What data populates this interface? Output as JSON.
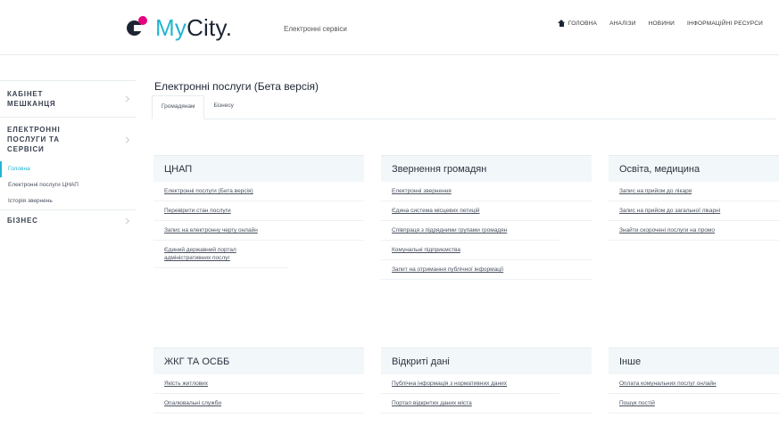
{
  "header": {
    "logo": {
      "my": "My",
      "city": "City.",
      "mark_icon": "mycity-logo-mark"
    },
    "subtitle": "Електронні сервіси",
    "nav": [
      {
        "label": "ГОЛОВНА",
        "icon": "home-icon"
      },
      {
        "label": "АНАЛІЗИ"
      },
      {
        "label": "НОВИНИ"
      },
      {
        "label": "ІНФОРМАЦІЙНІ РЕСУРСИ"
      }
    ]
  },
  "sidebar": {
    "sections": [
      {
        "title": "КАБІНЕТ МЕШКАНЦЯ"
      },
      {
        "title": "ЕЛЕКТРОННІ ПОСЛУГИ ТА СЕРВІСИ"
      },
      {
        "title": "БІЗНЕС"
      }
    ],
    "items": [
      "Головна",
      "Електронні послуги ЦНАП",
      "Історія звернень"
    ]
  },
  "main": {
    "title": "Електронні послуги (Бета версія)",
    "tabs": [
      "Громадянам",
      "Бізнесу"
    ]
  },
  "cards": [
    {
      "title": "ЦНАП",
      "links": [
        "Електронні послуги (Бета версія)",
        "Перевірити стан послуги",
        "Запис на електронну чергу онлайн",
        "Єдиний державний портал адміністративних послуг"
      ]
    },
    {
      "title": "Звернення громадян",
      "links": [
        "Електронні звернення",
        "Єдина система місцевих петицій",
        "Співпраця з підрядними групами громадян",
        "Комунальні підприємства",
        "Запит на отримання публічної інформації"
      ]
    },
    {
      "title": "Освіта, медицина",
      "links": [
        "Запис на прийом до лікаря",
        "Запис на прийом до загальної лікарні",
        "Знайти скорочені послуги на промо"
      ]
    },
    {
      "title": "ЖКГ ТА ОСББ",
      "links": [
        "Якість житлових",
        "Опалювальні служби"
      ]
    },
    {
      "title": "Відкриті дані",
      "links": [
        "Публічна інформація з нормативних даних",
        "Портал відкритих даних міста"
      ]
    },
    {
      "title": "Інше",
      "links": [
        "Оплата комунальних послуг онлайн",
        "Пошук постій"
      ]
    }
  ]
}
